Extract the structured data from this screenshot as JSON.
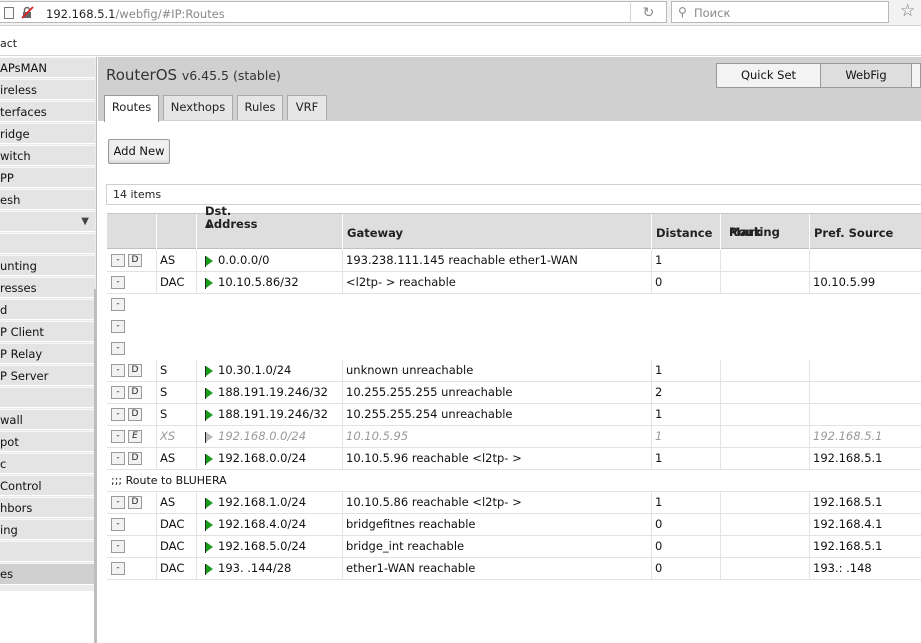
{
  "browser": {
    "url_host": "192.168.5.1",
    "url_path": "/webfig/#IP:Routes",
    "search_placeholder": "Поиск",
    "strip_text": "act"
  },
  "sidebar": {
    "items": [
      {
        "label": "APsMAN",
        "name": "sidebar-item-capsman"
      },
      {
        "label": "ireless",
        "name": "sidebar-item-wireless"
      },
      {
        "label": "terfaces",
        "name": "sidebar-item-interfaces"
      },
      {
        "label": "ridge",
        "name": "sidebar-item-bridge"
      },
      {
        "label": "witch",
        "name": "sidebar-item-switch"
      },
      {
        "label": "PP",
        "name": "sidebar-item-ppp"
      },
      {
        "label": "esh",
        "name": "sidebar-item-mesh"
      },
      {
        "label": "",
        "name": "sidebar-item-ip"
      },
      {
        "label": "",
        "name": "sidebar-item-blank"
      },
      {
        "label": "unting",
        "name": "sidebar-item-accounting"
      },
      {
        "label": "resses",
        "name": "sidebar-item-addresses"
      },
      {
        "label": "d",
        "name": "sidebar-item-cloud"
      },
      {
        "label": "P Client",
        "name": "sidebar-item-dhcp-client"
      },
      {
        "label": "P Relay",
        "name": "sidebar-item-dhcp-relay"
      },
      {
        "label": "P Server",
        "name": "sidebar-item-dhcp-server"
      },
      {
        "label": "",
        "name": "sidebar-item-dns"
      },
      {
        "label": "wall",
        "name": "sidebar-item-firewall"
      },
      {
        "label": "pot",
        "name": "sidebar-item-hotspot"
      },
      {
        "label": "c",
        "name": "sidebar-item-ipsec"
      },
      {
        "label": "Control",
        "name": "sidebar-item-kid-control"
      },
      {
        "label": "hbors",
        "name": "sidebar-item-neighbors"
      },
      {
        "label": "ing",
        "name": "sidebar-item-packing"
      },
      {
        "label": "",
        "name": "sidebar-item-pool"
      },
      {
        "label": "es",
        "name": "sidebar-item-routes"
      }
    ]
  },
  "header": {
    "title": "RouterOS",
    "version": "v6.45.5 (stable)",
    "quick_set_label": "Quick Set",
    "webfig_label": "WebFig"
  },
  "tabs": [
    {
      "label": "Routes",
      "name": "tab-routes"
    },
    {
      "label": "Nexthops",
      "name": "tab-nexthops"
    },
    {
      "label": "Rules",
      "name": "tab-rules"
    },
    {
      "label": "VRF",
      "name": "tab-vrf"
    }
  ],
  "toolbar": {
    "add_new_label": "Add New"
  },
  "count_text": "14 items",
  "table": {
    "sort_indicator": "▲",
    "columns": {
      "dst": "Dst. Address",
      "gateway": "Gateway",
      "distance": "Distance",
      "routing_mark_1": "Routing",
      "routing_mark_2": "Mark",
      "pref_source": "Pref. Source"
    },
    "rows": [
      {
        "remove": "-",
        "toggle": "D",
        "flags": "AS",
        "dst": "0.0.0.0/0",
        "gateway": "193.238.111.145 reachable ether1-WAN",
        "distance": "1",
        "pref": ""
      },
      {
        "remove": "-",
        "toggle": "",
        "flags": "DAC",
        "dst": "10.10.5.86/32",
        "gateway": "<l2tp-            > reachable",
        "distance": "0",
        "pref": "10.10.5.99"
      },
      {
        "remove": "-",
        "toggle": "",
        "flags": "",
        "dst": "",
        "gateway": "",
        "distance": "",
        "pref": ""
      },
      {
        "remove": "-",
        "toggle": "",
        "flags": "",
        "dst": "",
        "gateway": "",
        "distance": "",
        "pref": ""
      },
      {
        "remove": "-",
        "toggle": "",
        "flags": "",
        "dst": "",
        "gateway": "",
        "distance": "",
        "pref": ""
      },
      {
        "remove": "-",
        "toggle": "D",
        "flags": "S",
        "dst": "10.30.1.0/24",
        "gateway": "unknown unreachable",
        "distance": "1",
        "pref": ""
      },
      {
        "remove": "-",
        "toggle": "D",
        "flags": "S",
        "dst": "188.191.19.246/32",
        "gateway": "10.255.255.255 unreachable",
        "distance": "2",
        "pref": ""
      },
      {
        "remove": "-",
        "toggle": "D",
        "flags": "S",
        "dst": "188.191.19.246/32",
        "gateway": "10.255.255.254 unreachable",
        "distance": "1",
        "pref": ""
      },
      {
        "remove": "-",
        "toggle": "E",
        "flags": "XS",
        "dst": "192.168.0.0/24",
        "gateway": "10.10.5.95",
        "distance": "1",
        "pref": "192.168.5.1",
        "disabled": true
      },
      {
        "remove": "-",
        "toggle": "D",
        "flags": "AS",
        "dst": "192.168.0.0/24",
        "gateway": "10.10.5.96 reachable <l2tp-        >",
        "distance": "1",
        "pref": "192.168.5.1"
      },
      {
        "comment": ";;; Route to BLUHERA"
      },
      {
        "remove": "-",
        "toggle": "D",
        "flags": "AS",
        "dst": "192.168.1.0/24",
        "gateway": "10.10.5.86 reachable <l2tp-            >",
        "distance": "1",
        "pref": "192.168.5.1"
      },
      {
        "remove": "-",
        "toggle": "",
        "flags": "DAC",
        "dst": "192.168.4.0/24",
        "gateway": "bridgefitnes reachable",
        "distance": "0",
        "pref": "192.168.4.1"
      },
      {
        "remove": "-",
        "toggle": "",
        "flags": "DAC",
        "dst": "192.168.5.0/24",
        "gateway": "bridge_int reachable",
        "distance": "0",
        "pref": "192.168.5.1"
      },
      {
        "remove": "-",
        "toggle": "",
        "flags": "DAC",
        "dst": "193.           .144/28",
        "gateway": "ether1-WAN reachable",
        "distance": "0",
        "pref": "193.:          .148"
      }
    ]
  }
}
